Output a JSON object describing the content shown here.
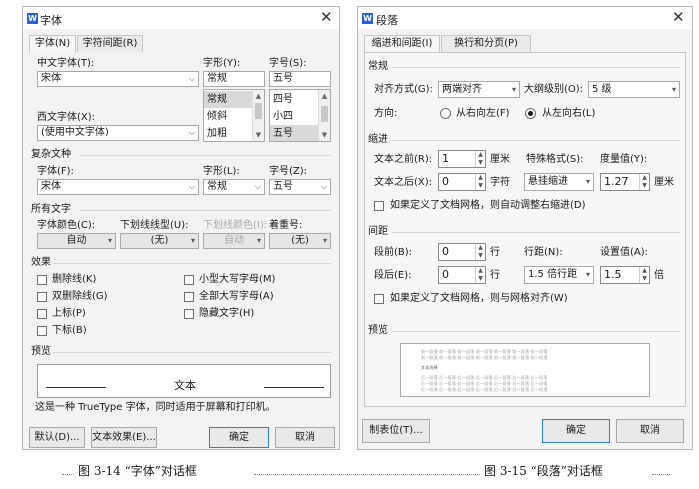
{
  "font_dialog": {
    "title": "字体",
    "app_icon_letter": "W",
    "close": "✕",
    "tabs": [
      "字体(N)",
      "字符间距(R)"
    ],
    "cn_font_label": "中文字体(T):",
    "cn_font_value": "宋体",
    "style_label": "字形(Y):",
    "style_value": "常规",
    "style_list": [
      "常规",
      "倾斜",
      "加粗"
    ],
    "size_label": "字号(S):",
    "size_value": "五号",
    "size_list": [
      "四号",
      "小四",
      "五号"
    ],
    "west_font_label": "西文字体(X):",
    "west_font_value": "(使用中文字体)",
    "complex_section": "复杂文种",
    "complex_font_label": "字体(F):",
    "complex_font_value": "宋体",
    "complex_style_label": "字形(L):",
    "complex_style_value": "常规",
    "complex_size_label": "字号(Z):",
    "complex_size_value": "五号",
    "all_text_section": "所有文字",
    "color_label": "字体颜色(C):",
    "color_value": "自动",
    "underline_label": "下划线线型(U):",
    "underline_value": "(无)",
    "underline_color_label": "下划线颜色(I):",
    "underline_color_value": "自动",
    "emphasis_label": "着重号:",
    "emphasis_value": "(无)",
    "effects_section": "效果",
    "effects_left": [
      "删除线(K)",
      "双删除线(G)",
      "上标(P)",
      "下标(B)"
    ],
    "effects_right": [
      "小型大写字母(M)",
      "全部大写字母(A)",
      "隐藏文字(H)"
    ],
    "preview_section": "预览",
    "preview_sample": "文本",
    "truetype_note": "这是一种 TrueType 字体，同时适用于屏幕和打印机。",
    "buttons": {
      "default": "默认(D)...",
      "text_effects": "文本效果(E)...",
      "ok": "确定",
      "cancel": "取消"
    }
  },
  "para_dialog": {
    "title": "段落",
    "app_icon_letter": "W",
    "close": "✕",
    "tabs": [
      "缩进和间距(I)",
      "换行和分页(P)"
    ],
    "general_section": "常规",
    "align_label": "对齐方式(G):",
    "align_value": "两端对齐",
    "outline_label": "大纲级别(O):",
    "outline_value": "5 级",
    "direction_label": "方向:",
    "rtl_label": "从右向左(F)",
    "ltr_label": "从左向右(L)",
    "indent_section": "缩进",
    "before_text_label": "文本之前(R):",
    "before_text_value": "1",
    "before_text_unit": "厘米",
    "special_label": "特殊格式(S):",
    "special_value": "悬挂缩进",
    "measure_label": "度量值(Y):",
    "measure_value": "1.27",
    "measure_unit": "厘米",
    "after_text_label": "文本之后(X):",
    "after_text_value": "0",
    "after_text_unit": "字符",
    "auto_indent_label": "如果定义了文档网格，则自动调整右缩进(D)",
    "spacing_section": "间距",
    "before_para_label": "段前(B):",
    "before_para_value": "0",
    "before_para_unit": "行",
    "line_spacing_label": "行距(N):",
    "line_spacing_value": "1.5 倍行距",
    "set_value_label": "设置值(A):",
    "set_value_value": "1.5",
    "set_value_unit": "倍",
    "after_para_label": "段后(E):",
    "after_para_value": "0",
    "after_para_unit": "行",
    "snap_grid_label": "如果定义了文档网格，则与网格对齐(W)",
    "preview_section": "预览",
    "preview_gray_text": "前一段落·前一段落·前一段落·前一段落·前一段落·前一段落·前一段落",
    "preview_dark_text": "文本选择",
    "preview_next_text": "后一段落·后一段落·后一段落·后一段落·后一段落·后一段落·后一段落",
    "buttons": {
      "tabs": "制表位(T)...",
      "ok": "确定",
      "cancel": "取消"
    }
  },
  "captions": {
    "left": "图 3-14 “字体”对话框",
    "right": "图 3-15 “段落”对话框"
  },
  "colors": {
    "primary_border": "#2f7be0",
    "app_icon": "#2b5fd9"
  }
}
